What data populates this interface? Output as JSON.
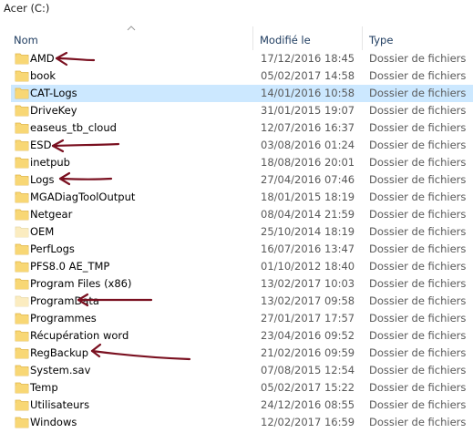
{
  "breadcrumb": "Acer (C:)",
  "columns": {
    "name": "Nom",
    "modified": "Modifié le",
    "type": "Type"
  },
  "rows": [
    {
      "name": "AMD",
      "modified": "17/12/2016 18:45",
      "type": "Dossier de fichiers"
    },
    {
      "name": "book",
      "modified": "05/02/2017 14:58",
      "type": "Dossier de fichiers"
    },
    {
      "name": "CAT-Logs",
      "modified": "14/01/2016 10:58",
      "type": "Dossier de fichiers",
      "selected": true
    },
    {
      "name": "DriveKey",
      "modified": "31/01/2015 19:07",
      "type": "Dossier de fichiers"
    },
    {
      "name": "easeus_tb_cloud",
      "modified": "12/07/2016 16:37",
      "type": "Dossier de fichiers"
    },
    {
      "name": "ESD",
      "modified": "03/08/2016 01:24",
      "type": "Dossier de fichiers"
    },
    {
      "name": "inetpub",
      "modified": "18/08/2016 20:01",
      "type": "Dossier de fichiers"
    },
    {
      "name": "Logs",
      "modified": "27/04/2016 07:46",
      "type": "Dossier de fichiers"
    },
    {
      "name": "MGADiagToolOutput",
      "modified": "18/01/2015 18:19",
      "type": "Dossier de fichiers"
    },
    {
      "name": "Netgear",
      "modified": "08/04/2014 21:59",
      "type": "Dossier de fichiers"
    },
    {
      "name": "OEM",
      "modified": "25/10/2014 18:19",
      "type": "Dossier de fichiers",
      "faded": true
    },
    {
      "name": "PerfLogs",
      "modified": "16/07/2016 13:47",
      "type": "Dossier de fichiers"
    },
    {
      "name": "PFS8.0 AE_TMP",
      "modified": "01/10/2012 18:40",
      "type": "Dossier de fichiers"
    },
    {
      "name": "Program Files (x86)",
      "modified": "13/02/2017 10:03",
      "type": "Dossier de fichiers"
    },
    {
      "name": "ProgramData",
      "modified": "13/02/2017 09:58",
      "type": "Dossier de fichiers",
      "faded": true
    },
    {
      "name": "Programmes",
      "modified": "27/01/2017 17:57",
      "type": "Dossier de fichiers"
    },
    {
      "name": "Récupération word",
      "modified": "23/04/2016 09:52",
      "type": "Dossier de fichiers"
    },
    {
      "name": "RegBackup",
      "modified": "21/02/2016 09:59",
      "type": "Dossier de fichiers"
    },
    {
      "name": "System.sav",
      "modified": "07/08/2015 12:54",
      "type": "Dossier de fichiers"
    },
    {
      "name": "Temp",
      "modified": "05/02/2017 15:22",
      "type": "Dossier de fichiers"
    },
    {
      "name": "Utilisateurs",
      "modified": "24/12/2016 08:55",
      "type": "Dossier de fichiers"
    },
    {
      "name": "Windows",
      "modified": "12/02/2017 16:59",
      "type": "Dossier de fichiers"
    }
  ],
  "colors": {
    "selection": "#cce8ff",
    "folder": "#f8d775",
    "folder_faded": "#fbecc0",
    "annotation_arrow": "#7a1020"
  },
  "icons": {
    "folder": "folder-icon",
    "sort": "sort-ascending-icon"
  }
}
